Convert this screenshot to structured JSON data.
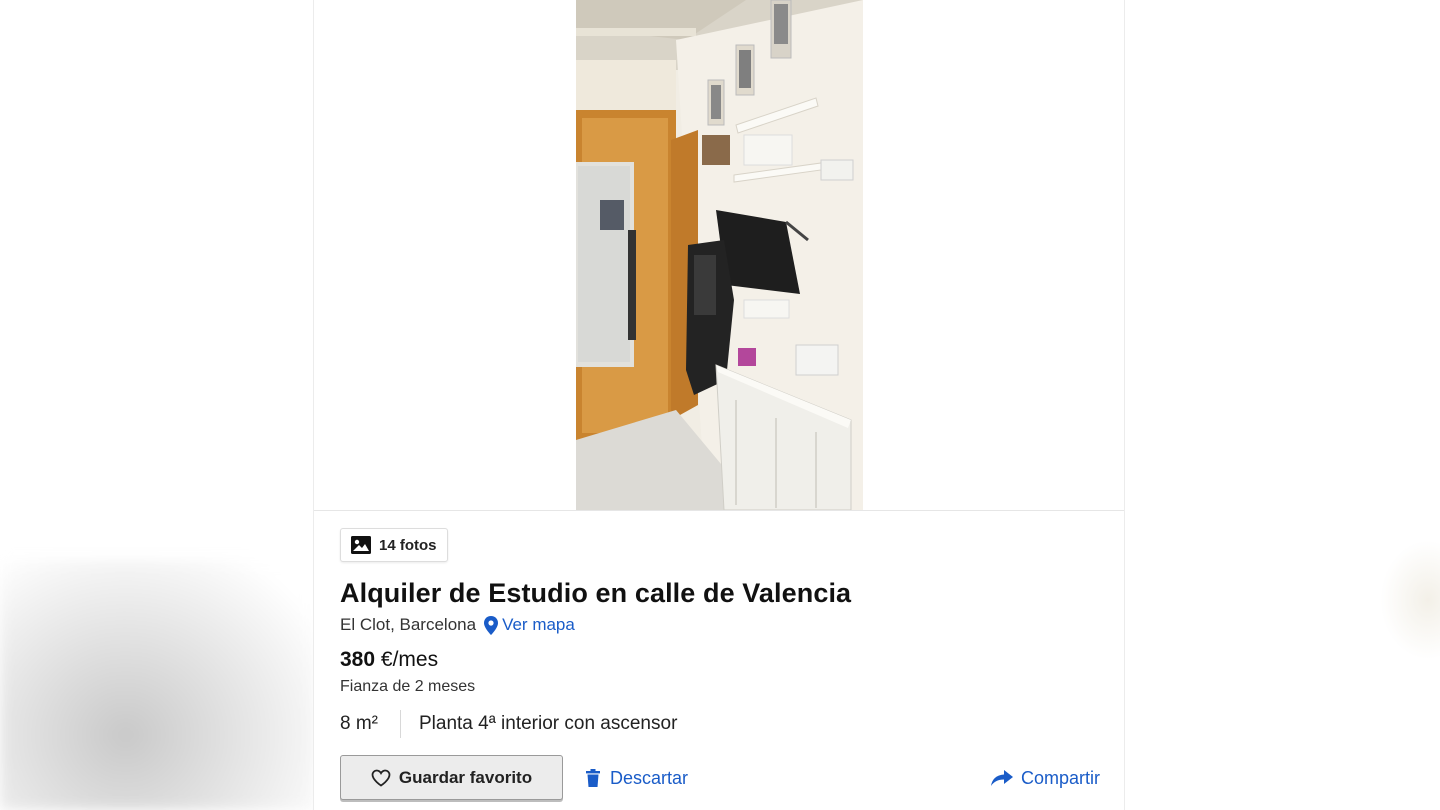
{
  "listing": {
    "photos_label": "14 fotos",
    "title": "Alquiler de Estudio en calle de Valencia",
    "location": "El Clot, Barcelona",
    "map_link": "Ver mapa",
    "price_amount": "380",
    "price_unit": "€/mes",
    "deposit": "Fianza de 2 meses",
    "area": "8 m²",
    "floor": "Planta 4ª interior con ascensor"
  },
  "actions": {
    "favorite_label": "Guardar favorito",
    "discard_label": "Descartar",
    "share_label": "Compartir"
  },
  "icons": {
    "photos": "image-icon",
    "map": "map-pin-icon",
    "favorite": "heart-icon",
    "discard": "trash-icon",
    "share": "share-arrow-icon"
  },
  "colors": {
    "link": "#1a5cc8",
    "title": "#111111",
    "button_bg": "#ececec"
  }
}
